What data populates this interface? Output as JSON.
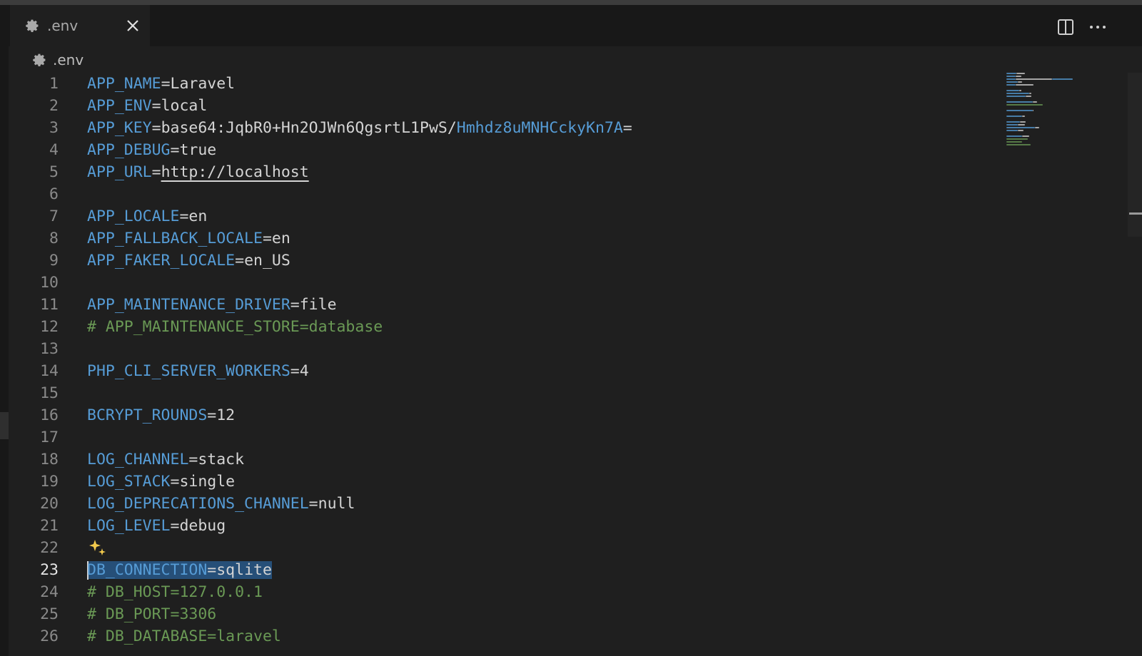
{
  "tab": {
    "label": ".env",
    "icon": "gear-icon"
  },
  "breadcrumb": {
    "label": ".env",
    "icon": "gear-icon"
  },
  "actions": {
    "split": "split-editor-icon",
    "more": "more-actions-icon"
  },
  "colors": {
    "key": "#569cd6",
    "value": "#d4d4d4",
    "comment": "#6a9955",
    "selection": "#264f78",
    "background": "#1f1f1f"
  },
  "editor": {
    "active_line": 23,
    "lines": [
      {
        "n": "1",
        "key": "APP_NAME",
        "eq": "=",
        "val": "Laravel"
      },
      {
        "n": "2",
        "key": "APP_ENV",
        "eq": "=",
        "val": "local"
      },
      {
        "n": "3",
        "key": "APP_KEY",
        "eq": "=",
        "val": "base64:JqbR0+Hn2OJWn6QgsrtL1PwS/",
        "val2": "Hmhdz8uMNHCckyKn7A",
        "tail": "="
      },
      {
        "n": "4",
        "key": "APP_DEBUG",
        "eq": "=",
        "val": "true"
      },
      {
        "n": "5",
        "key": "APP_URL",
        "eq": "=",
        "url": "http://localhost"
      },
      {
        "n": "6"
      },
      {
        "n": "7",
        "key": "APP_LOCALE",
        "eq": "=",
        "val": "en"
      },
      {
        "n": "8",
        "key": "APP_FALLBACK_LOCALE",
        "eq": "=",
        "val": "en"
      },
      {
        "n": "9",
        "key": "APP_FAKER_LOCALE",
        "eq": "=",
        "val": "en_US"
      },
      {
        "n": "10"
      },
      {
        "n": "11",
        "key": "APP_MAINTENANCE_DRIVER",
        "eq": "=",
        "val": "file"
      },
      {
        "n": "12",
        "comment": "# APP_MAINTENANCE_STORE=database"
      },
      {
        "n": "13"
      },
      {
        "n": "14",
        "key": "PHP_CLI_SERVER_WORKERS",
        "eq": "=",
        "val": "4"
      },
      {
        "n": "15"
      },
      {
        "n": "16",
        "key": "BCRYPT_ROUNDS",
        "eq": "=",
        "val": "12"
      },
      {
        "n": "17"
      },
      {
        "n": "18",
        "key": "LOG_CHANNEL",
        "eq": "=",
        "val": "stack"
      },
      {
        "n": "19",
        "key": "LOG_STACK",
        "eq": "=",
        "val": "single"
      },
      {
        "n": "20",
        "key": "LOG_DEPRECATIONS_CHANNEL",
        "eq": "=",
        "val": "null"
      },
      {
        "n": "21",
        "key": "LOG_LEVEL",
        "eq": "=",
        "val": "debug"
      },
      {
        "n": "22",
        "sparkle": "sparkle-icon"
      },
      {
        "n": "23",
        "key": "DB_CONNECTION",
        "eq": "=",
        "val": "sqlite",
        "selected": true
      },
      {
        "n": "24",
        "comment": "# DB_HOST=127.0.0.1"
      },
      {
        "n": "25",
        "comment": "# DB_PORT=3306"
      },
      {
        "n": "26",
        "comment": "# DB_DATABASE=laravel"
      }
    ]
  }
}
